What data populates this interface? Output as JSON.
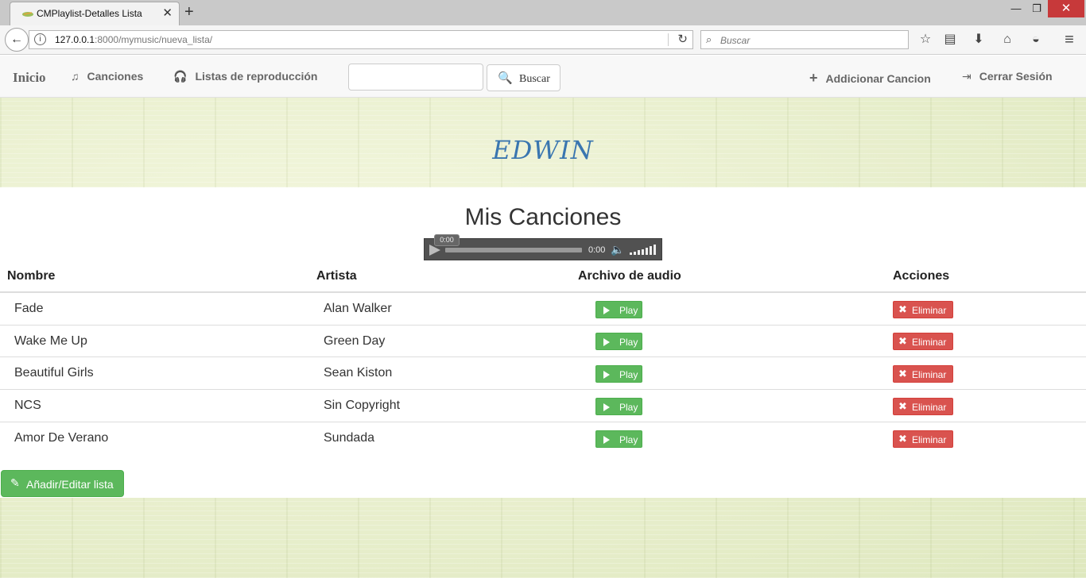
{
  "browser": {
    "tab_title": "CMPlaylist-Detalles Lista",
    "tab_close": "✕",
    "new_tab": "+",
    "win_min": "—",
    "win_max": "❐",
    "win_close": "✕",
    "back": "←",
    "url_host": "127.0.0.1",
    "url_rest": ":8000/mymusic/nueva_lista/",
    "reload": "↻",
    "search_placeholder": "Buscar",
    "info_glyph": "i",
    "search_glyph": "⌕",
    "toolbar_glyphs": {
      "bookmark": "☆",
      "library": "▤",
      "download": "⬇",
      "home": "⌂",
      "pocket": "◒",
      "menu": "≡"
    }
  },
  "app_nav": {
    "brand": "Inicio",
    "songs": "Canciones",
    "songs_icon": "♫",
    "playlists": "Listas de reproducción",
    "playlists_icon": "🎧",
    "search_button": "Buscar",
    "search_icon": "🔍",
    "add_song": "Addicionar Cancion",
    "add_icon": "+",
    "logout": "Cerrar Sesión",
    "logout_icon": "⇥"
  },
  "hero": {
    "title": "EDWIN"
  },
  "panel": {
    "title": "Mis Canciones",
    "audio": {
      "tooltip": "0:00",
      "time": "0:00",
      "mute_icon": "🔈"
    },
    "columns": [
      "Nombre",
      "Artista",
      "Archivo de audio",
      "Acciones"
    ],
    "rows": [
      {
        "name": "Fade",
        "artist": "Alan Walker"
      },
      {
        "name": "Wake Me Up",
        "artist": "Green Day"
      },
      {
        "name": "Beautiful Girls",
        "artist": "Sean Kiston"
      },
      {
        "name": "NCS",
        "artist": "Sin Copyright"
      },
      {
        "name": "Amor De Verano",
        "artist": "Sundada"
      }
    ],
    "play_label": "Play",
    "delete_label": "Eliminar",
    "delete_icon": "✖",
    "edit_button": "Añadir/Editar lista",
    "edit_icon": "✎"
  },
  "colors": {
    "play_green": "#5cb85c",
    "delete_red": "#d9534f",
    "hero_blue": "#3a76b0"
  }
}
